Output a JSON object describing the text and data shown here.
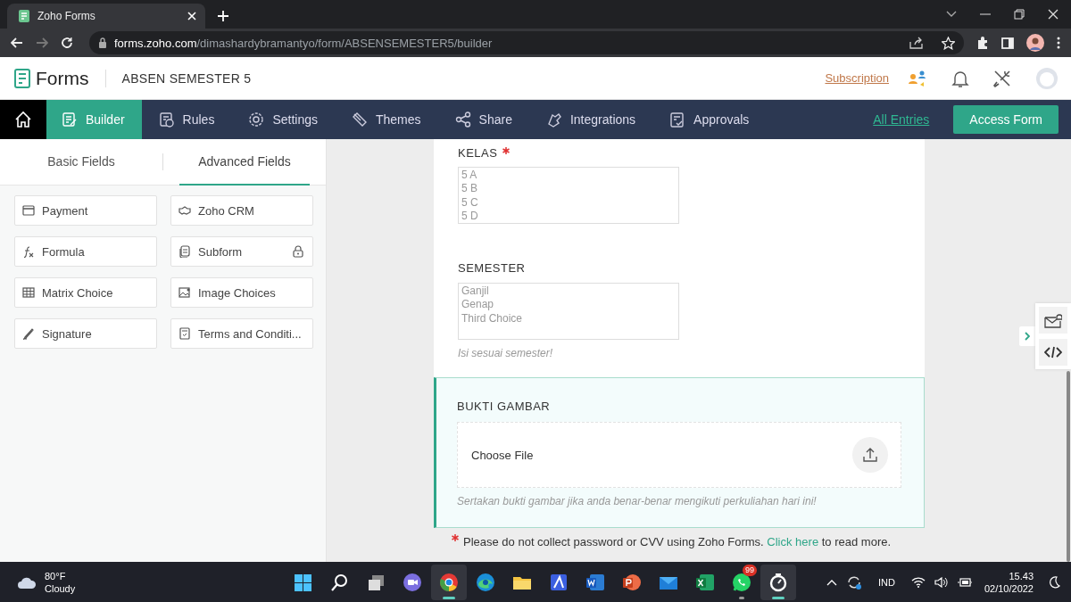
{
  "browser": {
    "tab_title": "Zoho Forms",
    "url_host": "forms.zoho.com",
    "url_path": "/dimashardybramantyo/form/ABSENSEMESTER5/builder"
  },
  "app_header": {
    "logo_text": "Forms",
    "form_name": "ABSEN SEMESTER 5",
    "subscription_link": "Subscription"
  },
  "nav": {
    "items": [
      {
        "label": "Builder",
        "kind": "builder",
        "selected": true
      },
      {
        "label": "Rules",
        "kind": "rules",
        "selected": false
      },
      {
        "label": "Settings",
        "kind": "settings",
        "selected": false
      },
      {
        "label": "Themes",
        "kind": "themes",
        "selected": false
      },
      {
        "label": "Share",
        "kind": "share",
        "selected": false
      },
      {
        "label": "Integrations",
        "kind": "integrations",
        "selected": false
      },
      {
        "label": "Approvals",
        "kind": "approvals",
        "selected": false
      }
    ],
    "all_entries": "All Entries",
    "access_form": "Access Form"
  },
  "left_panel": {
    "tabs": [
      {
        "label": "Basic Fields",
        "selected": false
      },
      {
        "label": "Advanced Fields",
        "selected": true
      }
    ],
    "fields": [
      {
        "label": "Payment",
        "kind": "payment",
        "locked": false
      },
      {
        "label": "Zoho CRM",
        "kind": "crm",
        "locked": false
      },
      {
        "label": "Formula",
        "kind": "formula",
        "locked": false
      },
      {
        "label": "Subform",
        "kind": "subform",
        "locked": true
      },
      {
        "label": "Matrix Choice",
        "kind": "matrix",
        "locked": false
      },
      {
        "label": "Image Choices",
        "kind": "image",
        "locked": false
      },
      {
        "label": "Signature",
        "kind": "signature",
        "locked": false
      },
      {
        "label": "Terms and Conditi...",
        "kind": "terms",
        "locked": false
      }
    ]
  },
  "form": {
    "fields": [
      {
        "kind": "listbox",
        "label": "KELAS",
        "required": true,
        "selected": false,
        "options": [
          "5 A",
          "5 B",
          "5 C",
          "5 D"
        ]
      },
      {
        "kind": "listbox",
        "label": "SEMESTER",
        "required": false,
        "selected": false,
        "options": [
          "Ganjil",
          "Genap",
          "Third Choice"
        ],
        "help": "Isi sesuai semester!"
      },
      {
        "kind": "file",
        "label": "BUKTI GAMBAR",
        "required": false,
        "selected": true,
        "button": "Choose File",
        "help": "Sertakan bukti gambar jika anda benar-benar mengikuti perkuliahan hari ini!"
      }
    ],
    "notice": {
      "text": "Please do not collect password or CVV using Zoho Forms.",
      "link": "Click here",
      "text_end": "to read more."
    }
  },
  "taskbar": {
    "weather_temp": "80°F",
    "weather_text": "Cloudy",
    "apps": [
      {
        "kind": "windows",
        "selected": false,
        "running": false
      },
      {
        "kind": "search",
        "selected": false,
        "running": false
      },
      {
        "kind": "taskview",
        "selected": false,
        "running": false
      },
      {
        "kind": "chat",
        "selected": false,
        "running": false
      },
      {
        "kind": "chrome",
        "selected": true,
        "running": true
      },
      {
        "kind": "edge",
        "selected": false,
        "running": false
      },
      {
        "kind": "folder",
        "selected": false,
        "running": false
      },
      {
        "kind": "editor",
        "selected": false,
        "running": false
      },
      {
        "kind": "word",
        "selected": false,
        "running": false
      },
      {
        "kind": "powerpoint",
        "selected": false,
        "running": false
      },
      {
        "kind": "mail",
        "selected": false,
        "running": false
      },
      {
        "kind": "excel",
        "selected": false,
        "running": false
      },
      {
        "kind": "whatsapp",
        "selected": false,
        "running": true,
        "badge": "99"
      },
      {
        "kind": "recorder",
        "selected": true,
        "running": true
      }
    ],
    "language": "IND",
    "time": "15.43",
    "date": "02/10/2022"
  }
}
